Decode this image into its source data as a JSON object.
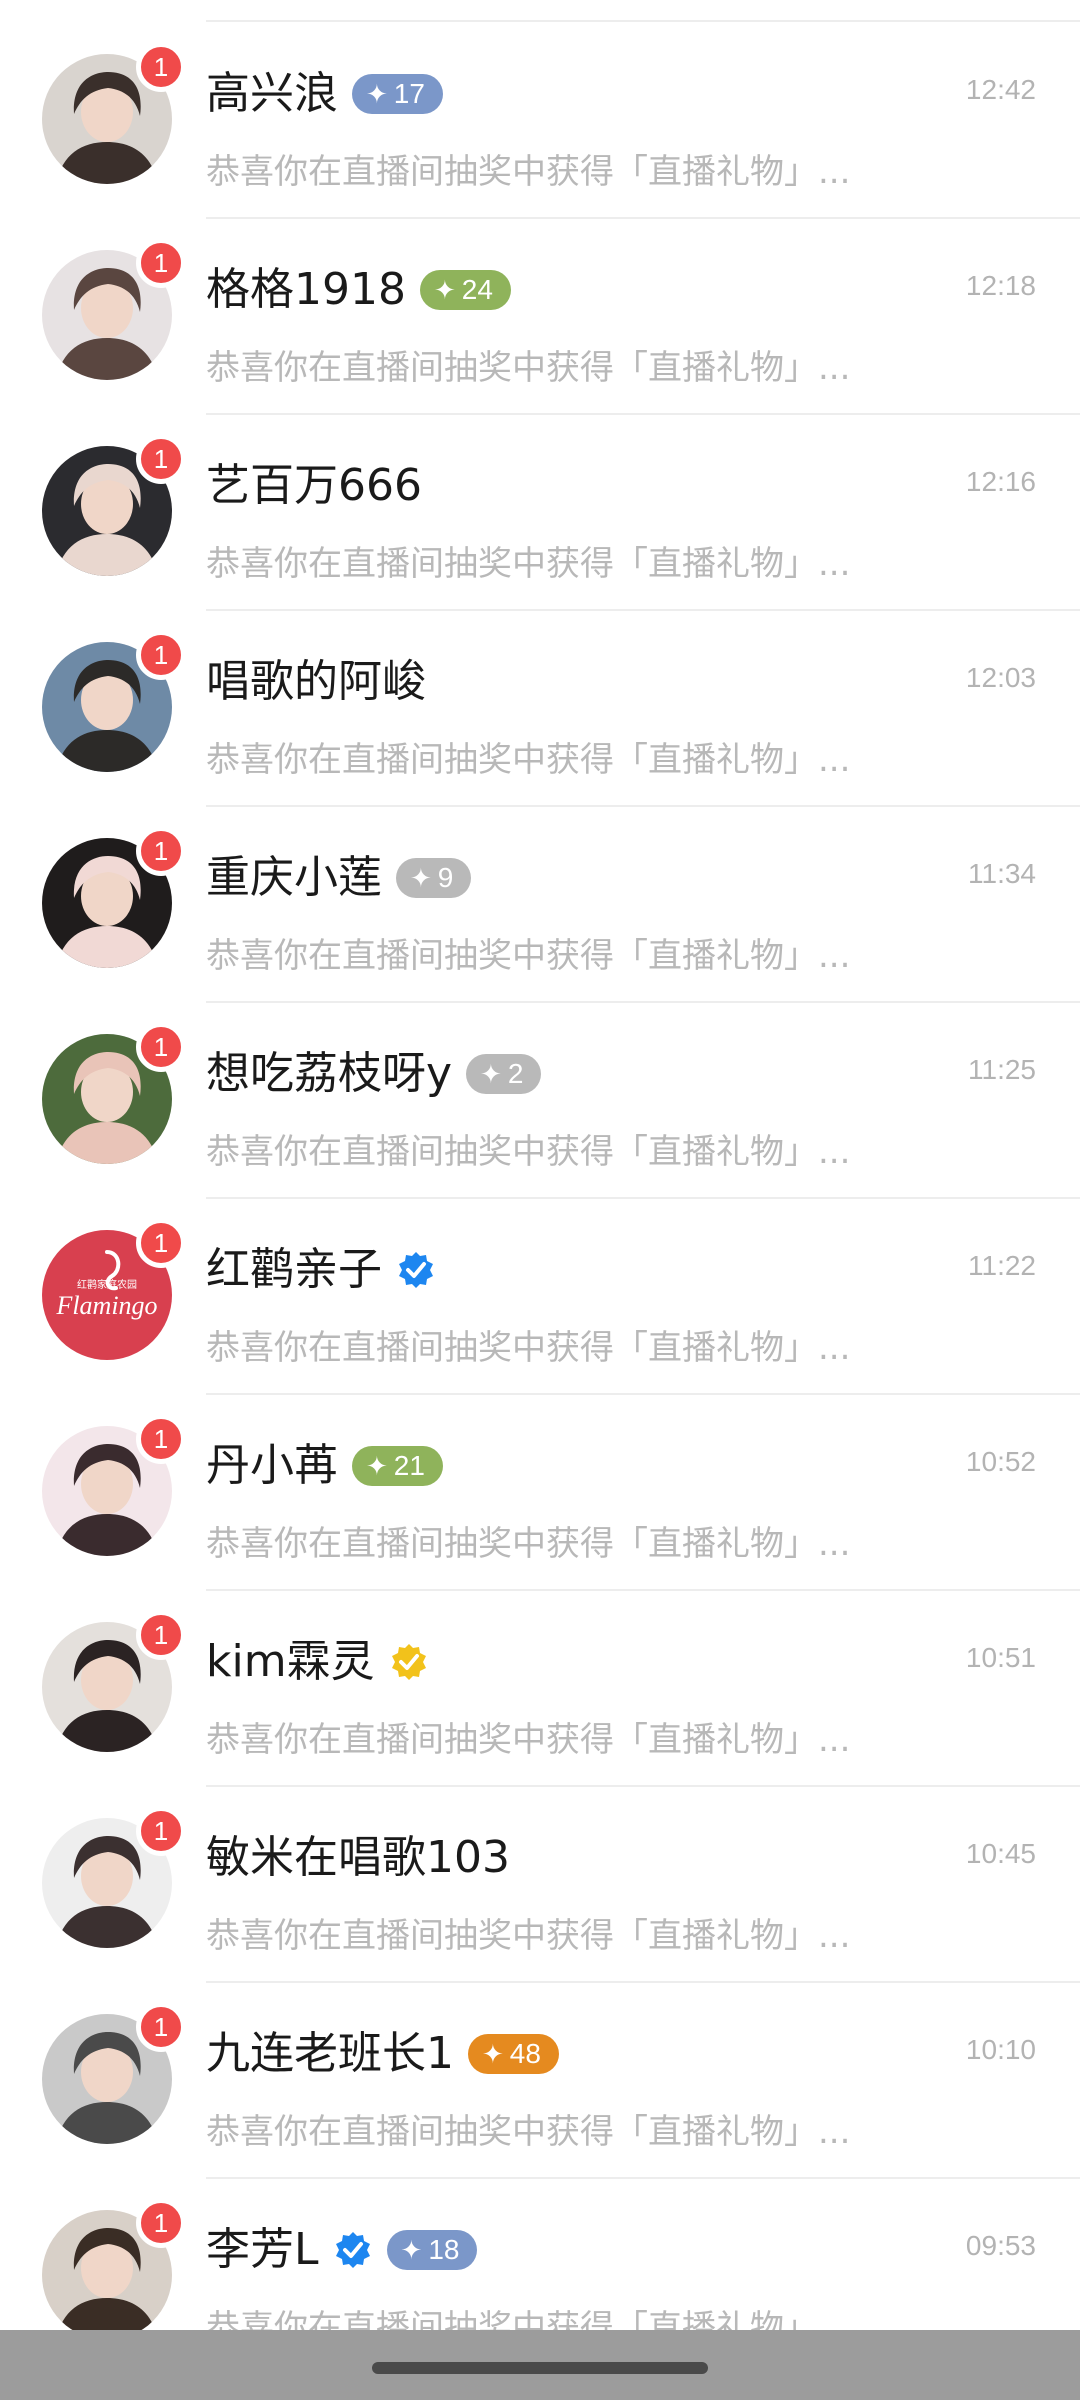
{
  "conversations": [
    {
      "name": "高兴浪",
      "time": "12:42",
      "unread": "1",
      "level": "17",
      "level_color": "#7b97c9",
      "verified": "",
      "preview": "恭喜你在直播间抽奖中获得「直播礼物」...",
      "avatar_colors": [
        "#d9d4cf",
        "#3a2f2b"
      ]
    },
    {
      "name": "格格1918",
      "time": "12:18",
      "unread": "1",
      "level": "24",
      "level_color": "#8fb35b",
      "verified": "",
      "preview": "恭喜你在直播间抽奖中获得「直播礼物」...",
      "avatar_colors": [
        "#e7e2e3",
        "#5a4640"
      ]
    },
    {
      "name": "艺百万666",
      "time": "12:16",
      "unread": "1",
      "level": "",
      "level_color": "",
      "verified": "",
      "preview": "恭喜你在直播间抽奖中获得「直播礼物」...",
      "avatar_colors": [
        "#2b2b2f",
        "#e9d7cf"
      ]
    },
    {
      "name": "唱歌的阿峻",
      "time": "12:03",
      "unread": "1",
      "level": "",
      "level_color": "",
      "verified": "",
      "preview": "恭喜你在直播间抽奖中获得「直播礼物」...",
      "avatar_colors": [
        "#6e8aa6",
        "#2c2a28"
      ]
    },
    {
      "name": "重庆小莲",
      "time": "11:34",
      "unread": "1",
      "level": "9",
      "level_color": "#b9b9b9",
      "verified": "",
      "preview": "恭喜你在直播间抽奖中获得「直播礼物」...",
      "avatar_colors": [
        "#1f1c1c",
        "#f1d9d5"
      ]
    },
    {
      "name": "想吃荔枝呀y",
      "time": "11:25",
      "unread": "1",
      "level": "2",
      "level_color": "#b9b9b9",
      "verified": "",
      "preview": "恭喜你在直播间抽奖中获得「直播礼物」...",
      "avatar_colors": [
        "#4d6b3c",
        "#e9c4b8"
      ]
    },
    {
      "name": "红鹳亲子",
      "time": "11:22",
      "unread": "1",
      "level": "",
      "level_color": "",
      "verified": "blue",
      "preview": "恭喜你在直播间抽奖中获得「直播礼物」...",
      "avatar_colors": [
        "#d8404f",
        "#ffffff"
      ],
      "avatar_logo": "Flamingo",
      "avatar_logo_cn": "红鹳家庭农园"
    },
    {
      "name": "丹小苒",
      "time": "10:52",
      "unread": "1",
      "level": "21",
      "level_color": "#8fb35b",
      "verified": "",
      "preview": "恭喜你在直播间抽奖中获得「直播礼物」...",
      "avatar_colors": [
        "#f3e6ea",
        "#3a2b2e"
      ]
    },
    {
      "name": "kim霖灵",
      "time": "10:51",
      "unread": "1",
      "level": "",
      "level_color": "",
      "verified": "gold",
      "preview": "恭喜你在直播间抽奖中获得「直播礼物」...",
      "avatar_colors": [
        "#e4e0dc",
        "#2b2323"
      ]
    },
    {
      "name": "敏米在唱歌103",
      "time": "10:45",
      "unread": "1",
      "level": "",
      "level_color": "",
      "verified": "",
      "preview": "恭喜你在直播间抽奖中获得「直播礼物」...",
      "avatar_colors": [
        "#eeeeee",
        "#3b3030"
      ]
    },
    {
      "name": "九连老班长1",
      "time": "10:10",
      "unread": "1",
      "level": "48",
      "level_color": "#e58a1f",
      "verified": "",
      "preview": "恭喜你在直播间抽奖中获得「直播礼物」...",
      "avatar_colors": [
        "#c9c9c9",
        "#4a4a4a"
      ]
    },
    {
      "name": "李芳L",
      "time": "09:53",
      "unread": "1",
      "level": "18",
      "level_color": "#7b97c9",
      "verified": "blue",
      "preview": "恭喜你在直播间抽奖中获得「直播礼物」...",
      "avatar_colors": [
        "#d8d0c8",
        "#3a2d25"
      ]
    }
  ],
  "colors": {
    "unread_badge": "#f04a4a",
    "verified_blue": "#1d86f0",
    "verified_gold": "#f2c21b"
  }
}
